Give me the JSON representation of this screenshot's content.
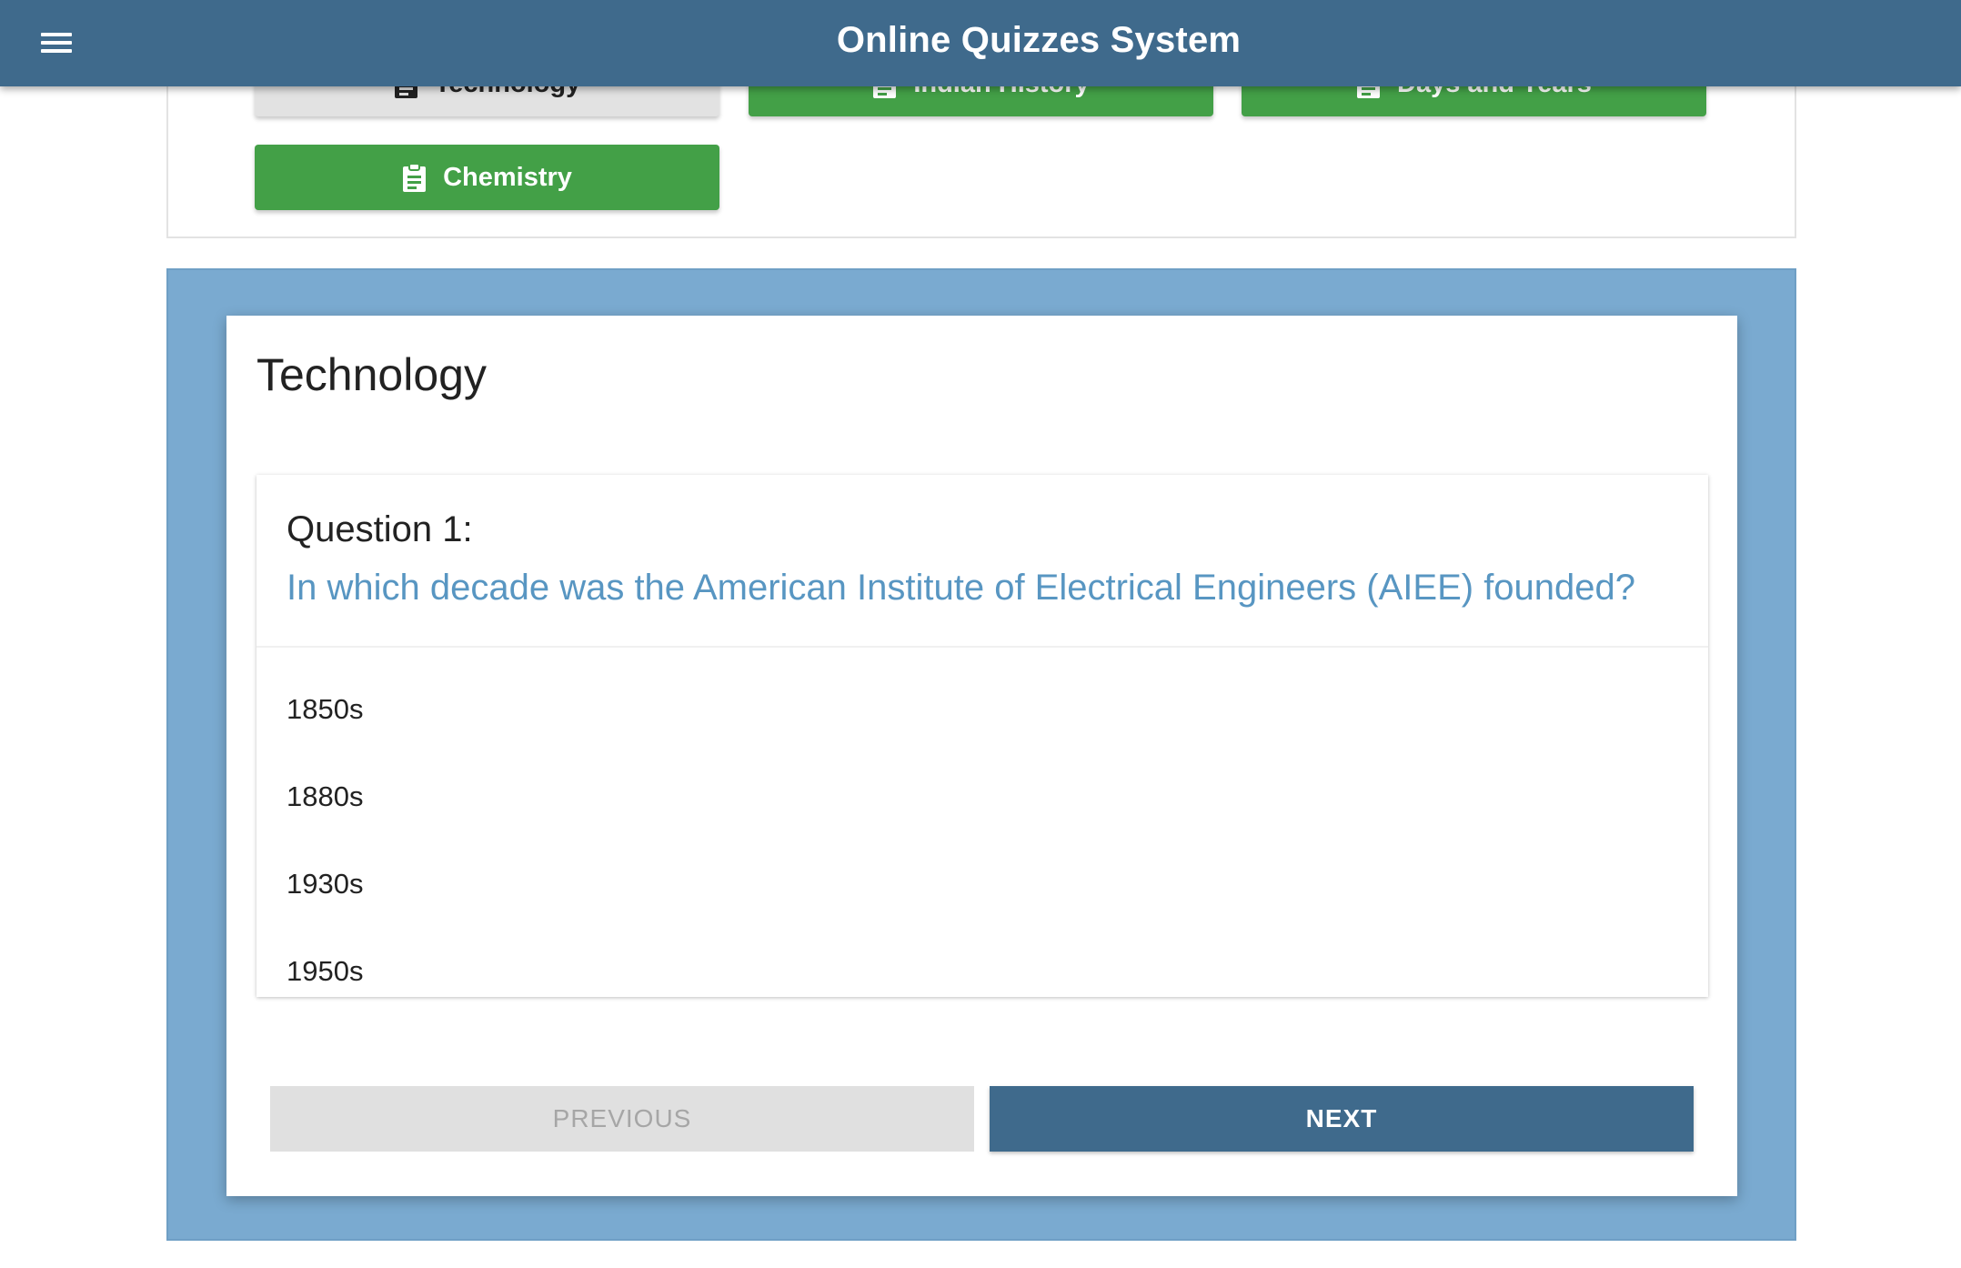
{
  "appbar": {
    "title": "Online Quizzes System",
    "menu_icon": "menu-icon",
    "color": "#3f6a8c"
  },
  "categories": {
    "items": [
      {
        "label": "Technology",
        "icon": "clipboard-icon",
        "selected": true
      },
      {
        "label": "Indian History",
        "icon": "clipboard-icon",
        "selected": false
      },
      {
        "label": "Days and Years",
        "icon": "clipboard-icon",
        "selected": false
      },
      {
        "label": "Chemistry",
        "icon": "clipboard-icon",
        "selected": false
      }
    ],
    "active_color": "#43a047"
  },
  "quiz": {
    "title": "Technology",
    "question_label": "Question 1:",
    "question_text": "In which decade was the American Institute of Electrical Engineers (AIEE) founded?",
    "options": [
      "1850s",
      "1880s",
      "1930s",
      "1950s"
    ],
    "previous_label": "PREVIOUS",
    "next_label": "NEXT",
    "question_color": "#5896c2",
    "backdrop_color": "#7aaad0"
  }
}
